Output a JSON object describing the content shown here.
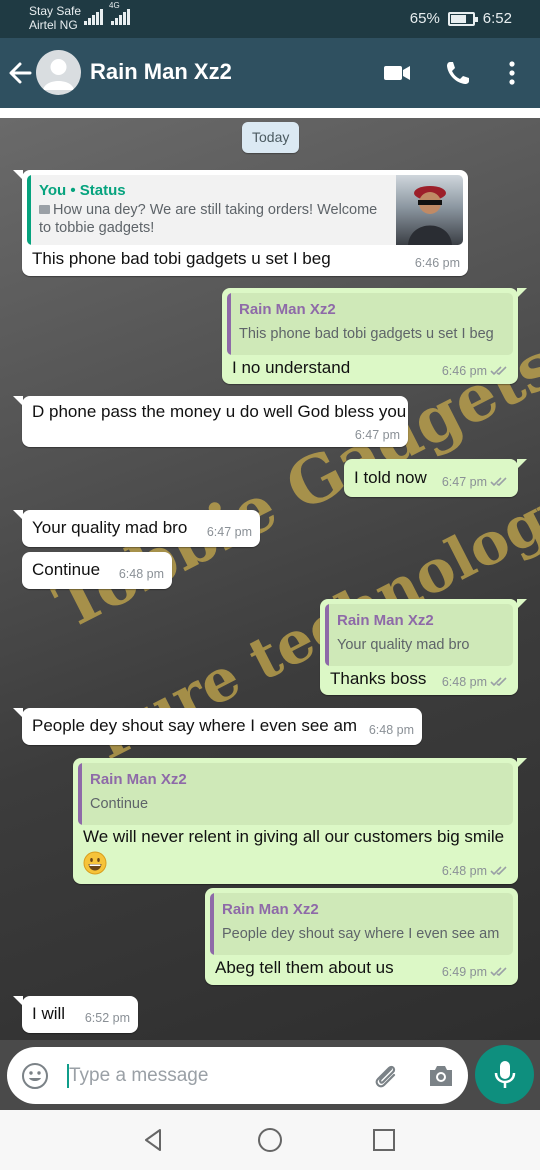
{
  "status_bar": {
    "carrier_line1": "Stay Safe",
    "carrier_line2": "Airtel NG",
    "network_type": "4G",
    "battery_percent": "65%",
    "battery_level": 0.65,
    "time": "6:52"
  },
  "header": {
    "contact_name": "Rain Man Xz2",
    "icons": [
      "back-arrow-icon",
      "avatar",
      "video-call-icon",
      "phone-icon",
      "more-vert-icon"
    ]
  },
  "chat": {
    "date_chip": "Today",
    "watermark_1": "Tobbie Gadgets",
    "watermark_2": "Pure technology",
    "messages": [
      {
        "direction": "in",
        "quote_author": "You • Status",
        "quote_text_1": "How una dey? We are still taking orders! Welcome",
        "quote_text_2": "to tobbie gadgets!",
        "text": "This phone bad tobi gadgets u set I beg",
        "time": "6:46 pm"
      },
      {
        "direction": "out",
        "quote_author": "Rain Man Xz2",
        "quote_text": "This phone bad tobi gadgets u set I beg",
        "text": "I no understand",
        "time": "6:46 pm"
      },
      {
        "direction": "in",
        "text": "D phone pass the money u do well God bless you",
        "time": "6:47 pm"
      },
      {
        "direction": "out",
        "text": "I told now",
        "time": "6:47 pm"
      },
      {
        "direction": "in",
        "text": "Your quality mad bro",
        "time": "6:47 pm"
      },
      {
        "direction": "in",
        "text": "Continue",
        "time": "6:48 pm"
      },
      {
        "direction": "out",
        "quote_author": "Rain Man Xz2",
        "quote_text": "Your quality mad bro",
        "text": "Thanks boss",
        "time": "6:48 pm"
      },
      {
        "direction": "in",
        "text": "People dey shout say where I even see am",
        "time": "6:48 pm"
      },
      {
        "direction": "out",
        "quote_author": "Rain Man Xz2",
        "quote_text": "Continue",
        "text": "We will never relent in giving all our customers big smile",
        "emoji": "😀",
        "time": "6:48 pm"
      },
      {
        "direction": "out",
        "quote_author": "Rain Man Xz2",
        "quote_text": "People dey shout say where I even see am",
        "text": "Abeg tell them about us",
        "time": "6:49 pm"
      },
      {
        "direction": "in",
        "text": "I will",
        "time": "6:52 pm"
      }
    ]
  },
  "composer": {
    "placeholder": "Type a message",
    "icons": [
      "emoji-icon",
      "attach-icon",
      "camera-icon",
      "mic-icon"
    ]
  },
  "navbar": {
    "icons": [
      "nav-back-icon",
      "nav-home-icon",
      "nav-recents-icon"
    ]
  },
  "colors": {
    "status_bar": "#1f3a43",
    "app_bar": "#2f5060",
    "incoming_bubble": "#ffffff",
    "outgoing_bubble": "#dcf8c6",
    "quote_you_accent": "#06a37e",
    "quote_contact_accent": "#8e6aa8",
    "mic_button": "#0e8f7e",
    "read_ticks": "#9aa0a6"
  }
}
